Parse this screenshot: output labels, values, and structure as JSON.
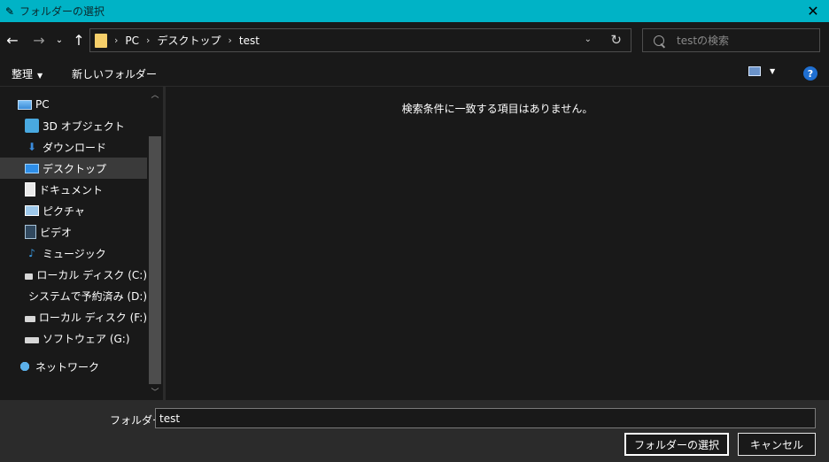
{
  "window": {
    "title": "フォルダーの選択",
    "close_glyph": "✕",
    "app_icon": "feather-icon"
  },
  "nav": {
    "back_glyph": "←",
    "forward_glyph": "→",
    "recent_glyph": "⌄",
    "up_glyph": "↑",
    "breadcrumb": [
      "PC",
      "デスクトップ",
      "test"
    ],
    "separator": "›",
    "dropdown_glyph": "⌄",
    "refresh_glyph": "↻",
    "search_placeholder": "testの検索"
  },
  "toolbar": {
    "organize_label": "整理",
    "organize_caret": "▼",
    "new_folder_label": "新しいフォルダー",
    "view_caret": "▼",
    "help_glyph": "?"
  },
  "sidebar": {
    "items": [
      {
        "label": "PC",
        "icon": "pc-icon",
        "level": 1
      },
      {
        "label": "3D オブジェクト",
        "icon": "3d-objects-icon",
        "level": 2
      },
      {
        "label": "ダウンロード",
        "icon": "download-icon",
        "level": 2
      },
      {
        "label": "デスクトップ",
        "icon": "desktop-icon",
        "level": 2,
        "selected": true
      },
      {
        "label": "ドキュメント",
        "icon": "documents-icon",
        "level": 2
      },
      {
        "label": "ピクチャ",
        "icon": "pictures-icon",
        "level": 2
      },
      {
        "label": "ビデオ",
        "icon": "videos-icon",
        "level": 2
      },
      {
        "label": "ミュージック",
        "icon": "music-icon",
        "level": 2
      },
      {
        "label": "ローカル ディスク (C:)",
        "icon": "drive-icon",
        "level": 2
      },
      {
        "label": "システムで予約済み (D:)",
        "icon": "drive-icon",
        "level": 2
      },
      {
        "label": "ローカル ディスク (F:)",
        "icon": "drive-icon",
        "level": 2
      },
      {
        "label": "ソフトウェア (G:)",
        "icon": "drive-icon",
        "level": 2
      },
      {
        "label": "ネットワーク",
        "icon": "network-icon",
        "level": 1
      }
    ],
    "scroll_up_glyph": "︿",
    "scroll_down_glyph": "﹀"
  },
  "content": {
    "empty_message": "検索条件に一致する項目はありません。"
  },
  "footer": {
    "folder_label": "フォルダー:",
    "folder_value": "test",
    "select_button": "フォルダーの選択",
    "cancel_button": "キャンセル"
  },
  "colors": {
    "titlebar": "#00b3c6",
    "background": "#191919",
    "footer": "#2b2b2b",
    "selected": "#3a3a3a"
  }
}
